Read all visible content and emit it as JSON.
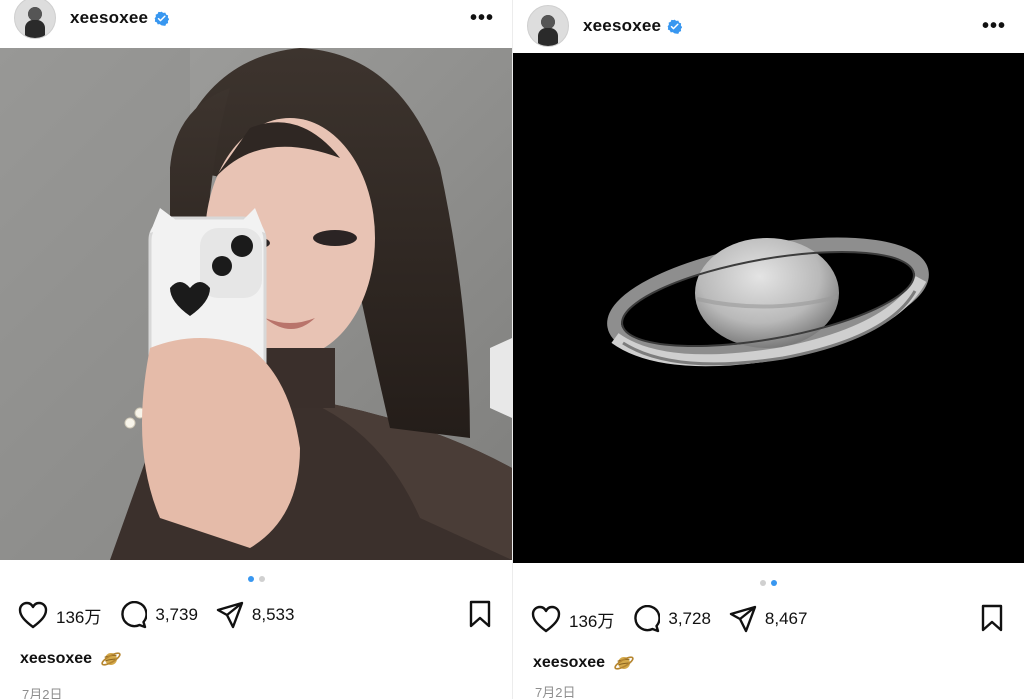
{
  "posts": [
    {
      "username": "xeesoxee",
      "likes": "136万",
      "comments": "3,739",
      "shares": "8,533",
      "caption_user": "xeesoxee",
      "date": "7月2日",
      "carousel": {
        "count": 2,
        "active": 1
      }
    },
    {
      "username": "xeesoxee",
      "likes": "136万",
      "comments": "3,728",
      "shares": "8,467",
      "caption_user": "xeesoxee",
      "date": "7月2日",
      "carousel": {
        "count": 2,
        "active": 2
      }
    }
  ],
  "colors": {
    "accent": "#3897f0",
    "verified": "#3897f0",
    "muted": "#8e8e8e"
  },
  "icons": {
    "more": "more-dots-icon",
    "like": "heart-icon",
    "comment": "comment-bubble-icon",
    "share": "paper-plane-icon",
    "save": "bookmark-icon",
    "caption_emoji": "ringed-planet-icon"
  }
}
